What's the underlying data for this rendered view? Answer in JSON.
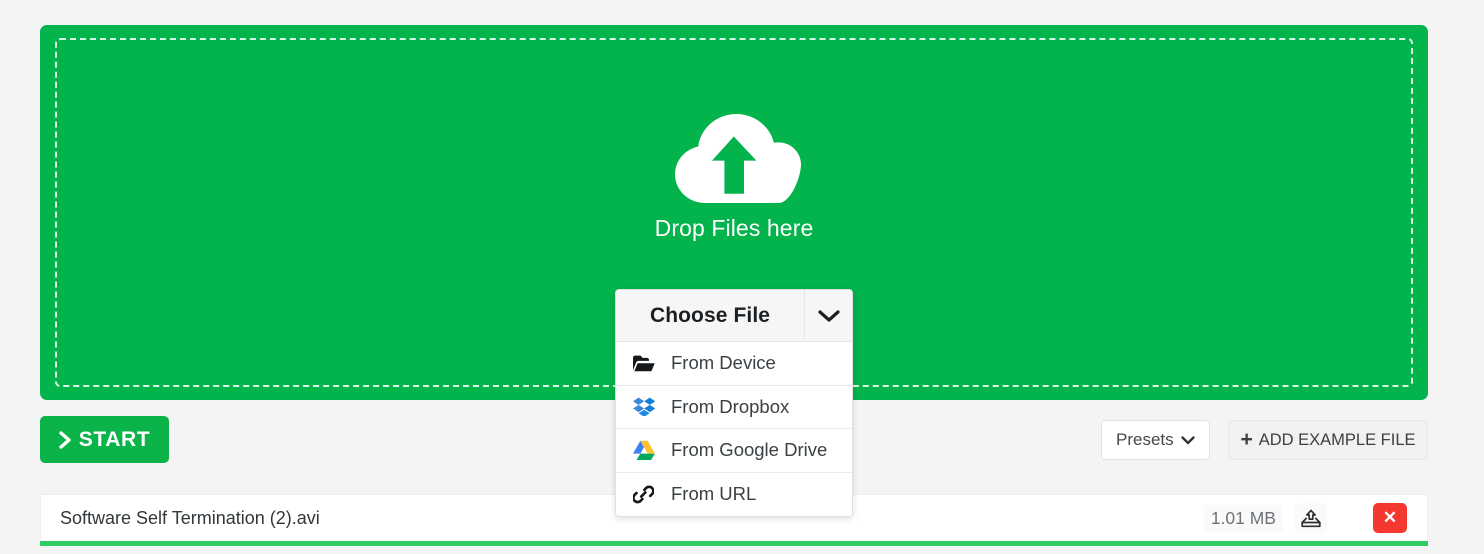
{
  "dropzone": {
    "icon": "cloud-upload-icon",
    "text": "Drop Files here",
    "bg_color": "#03b44c"
  },
  "chooser": {
    "title": "Choose File",
    "caret_icon": "chevron-down-icon",
    "items": [
      {
        "label": "From Device",
        "icon": "folder-open-icon"
      },
      {
        "label": "From Dropbox",
        "icon": "dropbox-icon"
      },
      {
        "label": "From Google Drive",
        "icon": "google-drive-icon"
      },
      {
        "label": "From URL",
        "icon": "link-icon"
      }
    ]
  },
  "actions": {
    "start_label": "START",
    "start_icon": "chevron-right-icon",
    "presets_label": "Presets",
    "presets_icon": "chevron-down-icon",
    "add_example_label": "ADD EXAMPLE FILE",
    "add_example_icon": "plus-icon"
  },
  "file_row": {
    "name": "Software Self Termination (2).avi",
    "size": "1.01 MB",
    "save_icon": "upload-save-icon",
    "remove_icon": "close-icon",
    "remove_label": "✕",
    "progress_percent": 100,
    "progress_color": "#2ecc63"
  }
}
